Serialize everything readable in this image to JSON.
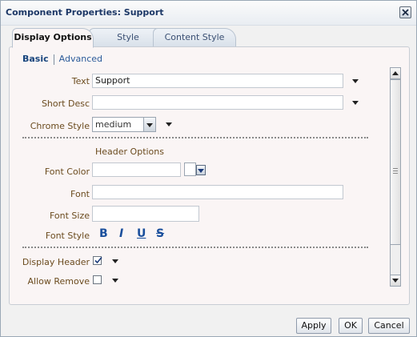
{
  "dialog": {
    "title": "Component Properties: Support"
  },
  "tabs": [
    {
      "label": "Display Options"
    },
    {
      "label": "Style"
    },
    {
      "label": "Content Style"
    }
  ],
  "subnav": {
    "basic": "Basic",
    "advanced": "Advanced"
  },
  "fields": {
    "text": {
      "label": "Text",
      "value": "Support"
    },
    "short_desc": {
      "label": "Short Desc",
      "value": ""
    },
    "chrome_style": {
      "label": "Chrome Style",
      "value": "medium"
    },
    "header_options": "Header Options",
    "font_color": {
      "label": "Font Color",
      "value": ""
    },
    "font": {
      "label": "Font",
      "value": ""
    },
    "font_size": {
      "label": "Font Size",
      "value": ""
    },
    "font_style": {
      "label": "Font Style",
      "bold": "B",
      "italic": "I",
      "underline": "U",
      "strike": "S"
    },
    "display_header": {
      "label": "Display Header",
      "checked": true
    },
    "allow_remove": {
      "label": "Allow Remove",
      "checked": false
    }
  },
  "buttons": {
    "apply": "Apply",
    "ok": "OK",
    "cancel": "Cancel"
  },
  "colors": {
    "accent": "#1b4f9c",
    "label": "#6b4b1e",
    "panel": "#faf5f5"
  },
  "icons": [
    "close-icon",
    "dropdown-arrow-icon",
    "checkmark-icon",
    "scroll-up-icon",
    "scroll-down-icon"
  ]
}
